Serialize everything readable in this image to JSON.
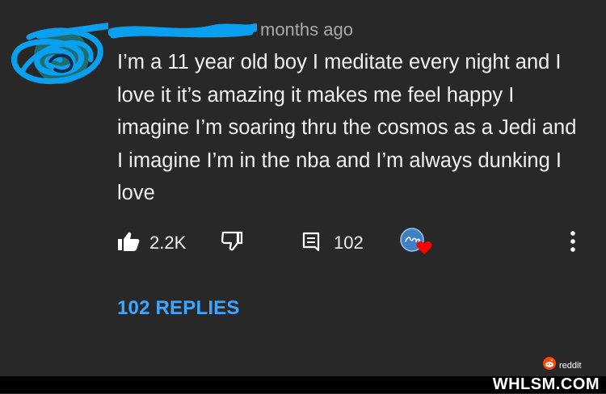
{
  "comment": {
    "timestamp": "months ago",
    "text": "I’m a 11 year old boy I meditate every night and I love it it’s amazing it makes me feel happy I imagine I’m soaring thru the cosmos as a Jedi and I imagine I’m in the nba and I’m always dunking I love",
    "author_redacted": true
  },
  "actions": {
    "likes": "2.2K",
    "reply_count": "102",
    "like_icon": "thumbs-up-icon",
    "dislike_icon": "thumbs-down-icon",
    "reply_icon": "comment-icon",
    "creator_heart_icon": "creator-heart-icon",
    "more_icon": "more-vertical-icon"
  },
  "replies": {
    "label": "102 REPLIES"
  },
  "watermarks": {
    "reddit": "reddit",
    "site": "WHLSM.COM"
  },
  "colors": {
    "background": "#282828",
    "text": "#f1f1f1",
    "secondary_text": "#aaaaaa",
    "link_blue": "#3ea6ff",
    "heart_red": "#ff0000",
    "scribble_blue": "#00a2f3",
    "reddit_orange": "#ff4500"
  }
}
